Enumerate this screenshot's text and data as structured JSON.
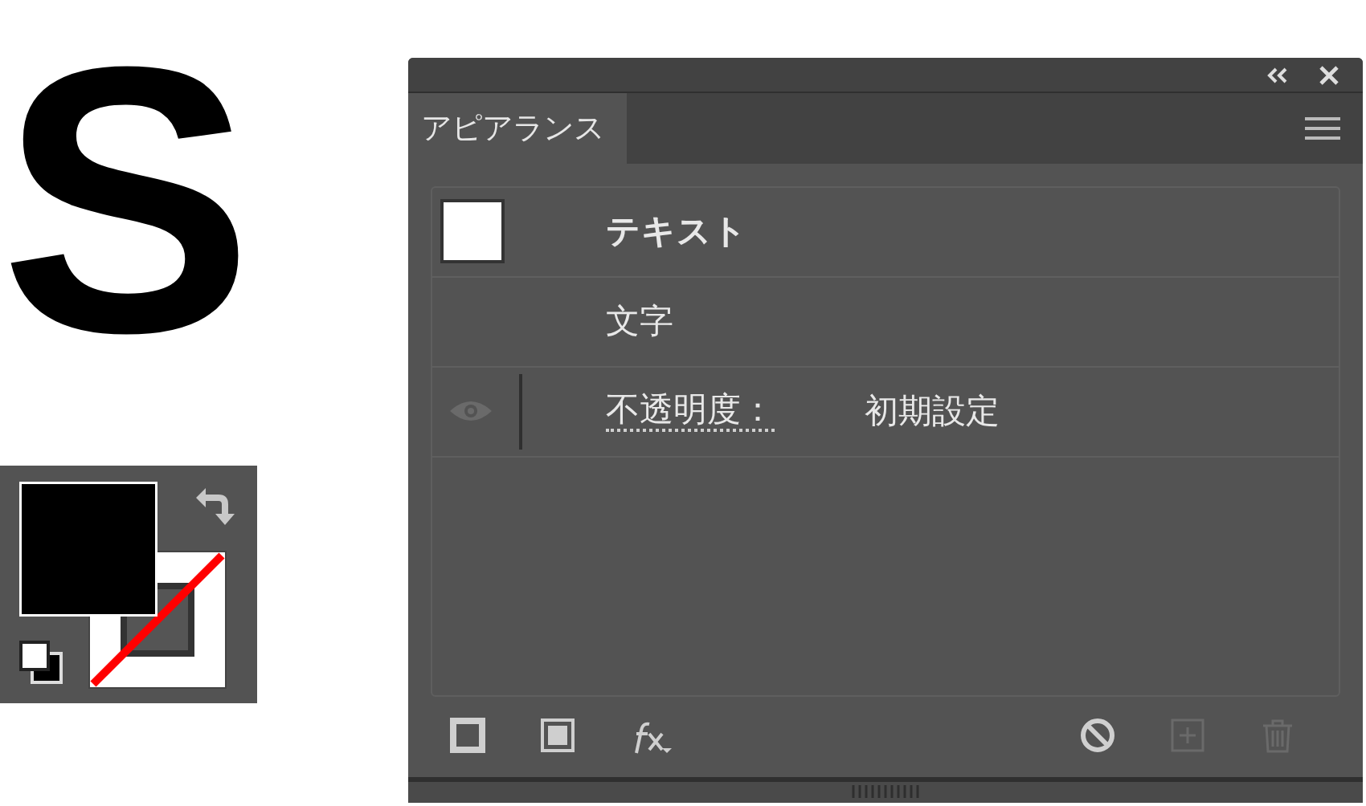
{
  "sample_letter": "S",
  "panel": {
    "tabs": [
      {
        "label": "アピアランス",
        "selected": true
      }
    ],
    "rows": [
      {
        "kind": "object",
        "label": "テキスト"
      },
      {
        "kind": "item",
        "label": "文字"
      },
      {
        "kind": "attribute",
        "label": "不透明度：",
        "value": "初期設定"
      }
    ],
    "toolbar": [
      {
        "kind": "stroke",
        "disabled": false
      },
      {
        "kind": "fill",
        "disabled": false
      },
      {
        "kind": "fx",
        "disabled": false
      },
      {
        "kind": "clear",
        "disabled": false
      },
      {
        "kind": "duplicate",
        "disabled": true
      },
      {
        "kind": "delete",
        "disabled": true
      }
    ]
  }
}
